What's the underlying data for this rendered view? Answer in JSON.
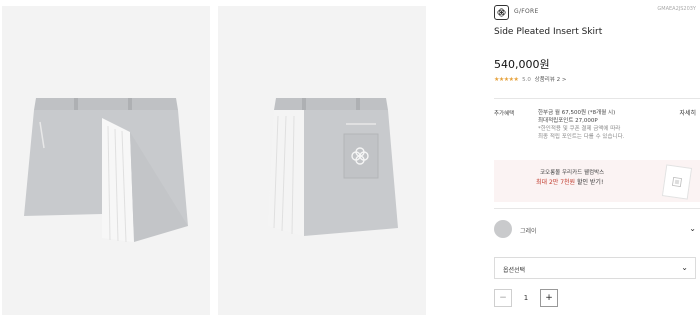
{
  "brand": {
    "name": "G/FORE",
    "logo_icon": "gfore-flower-logo-icon"
  },
  "product": {
    "code": "GMAEA2JS203Y",
    "title": "Side Pleated Insert Skirt",
    "price": "540,000원",
    "rating": {
      "stars": 5,
      "score": "5.0",
      "review_label": "상품리뷰 2 >"
    }
  },
  "benefit": {
    "label": "추가혜택",
    "line1": "한부금 월 67,500원 (*8개월 시)",
    "line2": "최대적립포인트 27,000P",
    "line3": "*한인적용 및 쿠폰 결제 금액에 따라",
    "line4": "최종 적립 포인트는 다를 수 있습니다.",
    "detail_link": "자세히"
  },
  "promo": {
    "line1": "코오롱몰 우리카드 웰컴박스",
    "line2_prefix": "최대 2만 7천원",
    "line2_suffix": " 할인 받기!"
  },
  "color": {
    "label": "그레이",
    "swatch_hex": "#c9cacc",
    "chevron": "⌄"
  },
  "option": {
    "label": "옵션선택",
    "caret": "⌄"
  },
  "quantity": {
    "value": "1",
    "minus": "−",
    "plus": "+"
  },
  "colors": {
    "price_text": "#111111",
    "promo_bg": "#fbf3f3",
    "star": "#e6a23c"
  }
}
